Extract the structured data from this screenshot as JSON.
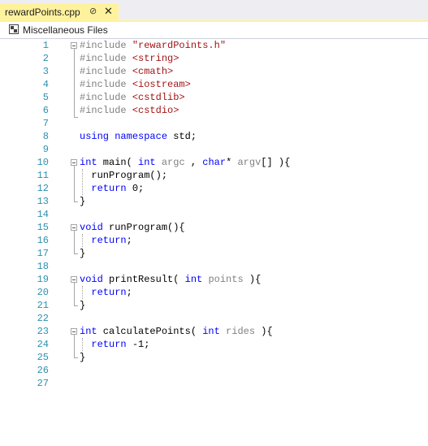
{
  "tab": {
    "title": "rewardPoints.cpp",
    "pin_icon": "pin-icon",
    "close_icon": "close-icon"
  },
  "nav": {
    "scope": "Miscellaneous Files",
    "icon": "misc-files-icon"
  },
  "editor": {
    "lines": [
      {
        "n": "1",
        "t": [
          {
            "c": "pp",
            "v": "#include "
          },
          {
            "c": "str",
            "v": "\"rewardPoints.h\""
          }
        ]
      },
      {
        "n": "2",
        "t": [
          {
            "c": "pp",
            "v": "#include "
          },
          {
            "c": "str",
            "v": "<string>"
          }
        ]
      },
      {
        "n": "3",
        "t": [
          {
            "c": "pp",
            "v": "#include "
          },
          {
            "c": "str",
            "v": "<cmath>"
          }
        ]
      },
      {
        "n": "4",
        "t": [
          {
            "c": "pp",
            "v": "#include "
          },
          {
            "c": "str",
            "v": "<iostream>"
          }
        ]
      },
      {
        "n": "5",
        "t": [
          {
            "c": "pp",
            "v": "#include "
          },
          {
            "c": "str",
            "v": "<cstdlib>"
          }
        ]
      },
      {
        "n": "6",
        "t": [
          {
            "c": "pp",
            "v": "#include "
          },
          {
            "c": "str",
            "v": "<cstdio>"
          }
        ]
      },
      {
        "n": "7",
        "t": []
      },
      {
        "n": "8",
        "t": [
          {
            "c": "kw",
            "v": "using"
          },
          {
            "c": "",
            "v": " "
          },
          {
            "c": "kw",
            "v": "namespace"
          },
          {
            "c": "",
            "v": " std;"
          }
        ]
      },
      {
        "n": "9",
        "t": []
      },
      {
        "n": "10",
        "t": [
          {
            "c": "kw",
            "v": "int"
          },
          {
            "c": "",
            "v": " main( "
          },
          {
            "c": "kw",
            "v": "int"
          },
          {
            "c": "",
            "v": " "
          },
          {
            "c": "prm",
            "v": "argc"
          },
          {
            "c": "",
            "v": " , "
          },
          {
            "c": "kw",
            "v": "char"
          },
          {
            "c": "",
            "v": "* "
          },
          {
            "c": "prm",
            "v": "argv"
          },
          {
            "c": "",
            "v": "[] ){"
          }
        ]
      },
      {
        "n": "11",
        "t": [
          {
            "c": "",
            "v": "  runProgram();"
          }
        ]
      },
      {
        "n": "12",
        "t": [
          {
            "c": "",
            "v": "  "
          },
          {
            "c": "kw",
            "v": "return"
          },
          {
            "c": "",
            "v": " 0;"
          }
        ]
      },
      {
        "n": "13",
        "t": [
          {
            "c": "",
            "v": "}"
          }
        ]
      },
      {
        "n": "14",
        "t": []
      },
      {
        "n": "15",
        "t": [
          {
            "c": "kw",
            "v": "void"
          },
          {
            "c": "",
            "v": " runProgram(){"
          }
        ]
      },
      {
        "n": "16",
        "t": [
          {
            "c": "",
            "v": "  "
          },
          {
            "c": "kw",
            "v": "return"
          },
          {
            "c": "",
            "v": ";"
          }
        ]
      },
      {
        "n": "17",
        "t": [
          {
            "c": "",
            "v": "}"
          }
        ]
      },
      {
        "n": "18",
        "t": []
      },
      {
        "n": "19",
        "t": [
          {
            "c": "kw",
            "v": "void"
          },
          {
            "c": "",
            "v": " printResult( "
          },
          {
            "c": "kw",
            "v": "int"
          },
          {
            "c": "",
            "v": " "
          },
          {
            "c": "prm",
            "v": "points"
          },
          {
            "c": "",
            "v": " ){"
          }
        ]
      },
      {
        "n": "20",
        "t": [
          {
            "c": "",
            "v": "  "
          },
          {
            "c": "kw",
            "v": "return"
          },
          {
            "c": "",
            "v": ";"
          }
        ]
      },
      {
        "n": "21",
        "t": [
          {
            "c": "",
            "v": "}"
          }
        ]
      },
      {
        "n": "22",
        "t": []
      },
      {
        "n": "23",
        "t": [
          {
            "c": "kw",
            "v": "int"
          },
          {
            "c": "",
            "v": " calculatePoints( "
          },
          {
            "c": "kw",
            "v": "int"
          },
          {
            "c": "",
            "v": " "
          },
          {
            "c": "prm",
            "v": "rides"
          },
          {
            "c": "",
            "v": " ){"
          }
        ]
      },
      {
        "n": "24",
        "t": [
          {
            "c": "",
            "v": "  "
          },
          {
            "c": "kw",
            "v": "return"
          },
          {
            "c": "",
            "v": " -1;"
          }
        ]
      },
      {
        "n": "25",
        "t": [
          {
            "c": "",
            "v": "}"
          }
        ]
      },
      {
        "n": "26",
        "t": []
      },
      {
        "n": "27",
        "t": []
      }
    ]
  }
}
